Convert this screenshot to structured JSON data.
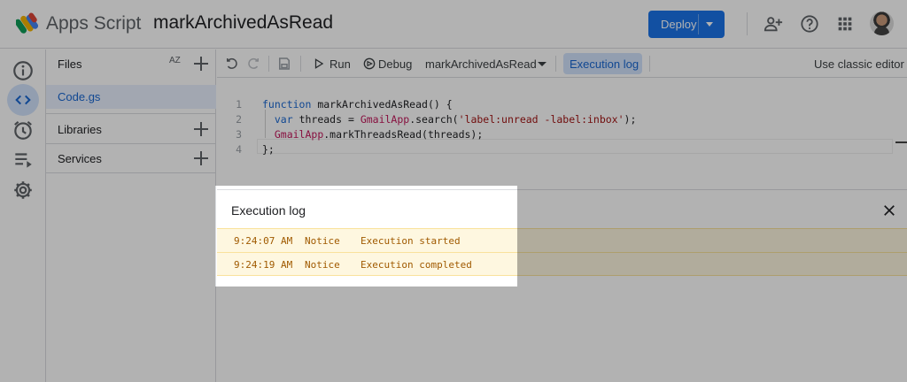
{
  "header": {
    "app_name": "Apps Script",
    "project_title": "markArchivedAsRead",
    "deploy_label": "Deploy"
  },
  "files_panel": {
    "title": "Files",
    "sort_label": "AZ",
    "files": [
      {
        "name": "Code.gs"
      }
    ],
    "sections": [
      {
        "label": "Libraries"
      },
      {
        "label": "Services"
      }
    ]
  },
  "toolbar": {
    "run_label": "Run",
    "debug_label": "Debug",
    "function_select": "markArchivedAsRead",
    "execution_log_label": "Execution log",
    "classic_editor_label": "Use classic editor"
  },
  "editor": {
    "line_numbers": [
      "1",
      "2",
      "3",
      "4"
    ]
  },
  "log_panel": {
    "title": "Execution log",
    "entries": [
      {
        "time": "9:24:07 AM",
        "level": "Notice",
        "message": "Execution started"
      },
      {
        "time": "9:24:19 AM",
        "level": "Notice",
        "message": "Execution completed"
      }
    ]
  },
  "colors": {
    "accent": "#1a73e8",
    "selection": "#d2e3fc",
    "log_row_bg": "#fef7e0",
    "log_text": "#a05a00"
  },
  "icons": {
    "rail": [
      "info-icon",
      "code-icon",
      "clock-icon",
      "executions-icon",
      "settings-icon"
    ],
    "header": [
      "apps-script-logo",
      "add-person-icon",
      "help-icon",
      "apps-grid-icon"
    ],
    "toolbar": [
      "undo-icon",
      "redo-icon",
      "save-icon",
      "run-icon",
      "debug-icon"
    ]
  }
}
